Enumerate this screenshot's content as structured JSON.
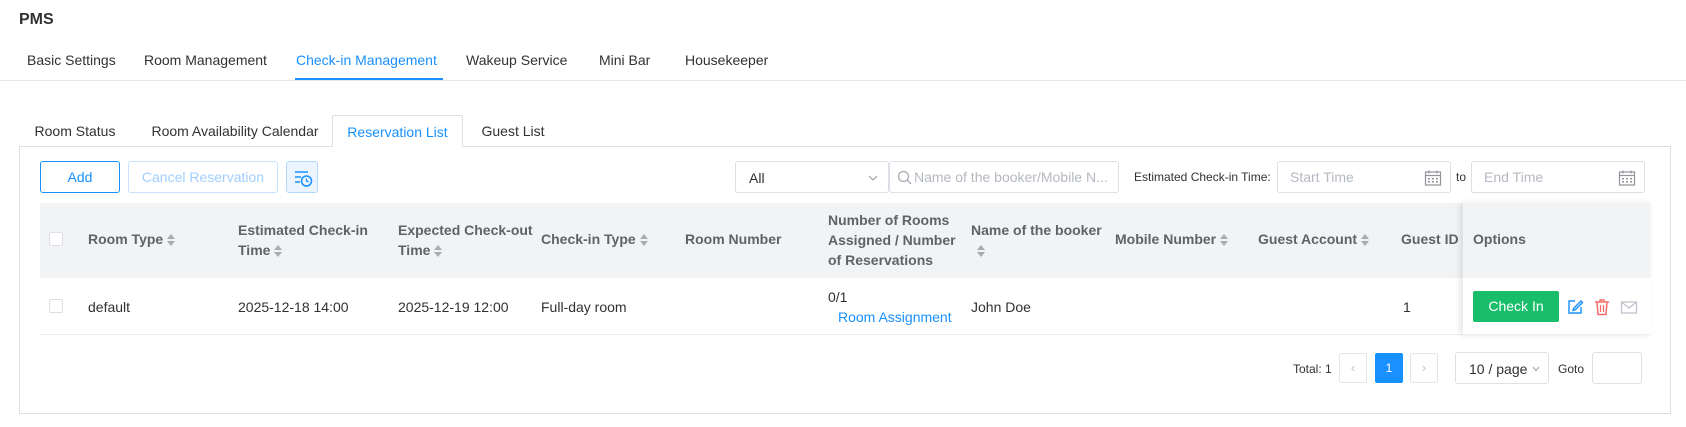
{
  "app": {
    "title": "PMS"
  },
  "top_tabs": [
    {
      "label": "Basic Settings"
    },
    {
      "label": "Room Management"
    },
    {
      "label": "Check-in Management",
      "active": true
    },
    {
      "label": "Wakeup Service"
    },
    {
      "label": "Mini Bar"
    },
    {
      "label": "Housekeeper"
    }
  ],
  "sub_tabs": [
    {
      "label": "Room Status"
    },
    {
      "label": "Room Availability Calendar"
    },
    {
      "label": "Reservation List",
      "active": true
    },
    {
      "label": "Guest List"
    }
  ],
  "toolbar": {
    "add_label": "Add",
    "cancel_label": "Cancel Reservation",
    "history_icon": "list-clock-icon",
    "status_select": "All",
    "search_placeholder": "Name of the booker/Mobile N...",
    "time_label": "Estimated Check-in Time:",
    "start_placeholder": "Start Time",
    "to_label": "to",
    "end_placeholder": "End Time"
  },
  "table": {
    "columns": {
      "room_type": "Room Type",
      "checkin_time_1": "Estimated Check-in",
      "checkin_time_2": "Time",
      "checkout_time_1": "Expected Check-out",
      "checkout_time_2": "Time",
      "checkin_type": "Check-in Type",
      "room_number": "Room Number",
      "rooms_assigned_1": "Number of Rooms",
      "rooms_assigned_2": "Assigned / Number",
      "rooms_assigned_3": "of Reservations",
      "booker_name": "Name of the booker",
      "mobile_number": "Mobile Number",
      "guest_account": "Guest Account",
      "guest_id": "Guest ID",
      "options": "Options"
    },
    "rows": [
      {
        "room_type": "default",
        "checkin_time": "2025-12-18 14:00",
        "checkout_time": "2025-12-19 12:00",
        "checkin_type": "Full-day room",
        "room_number": "",
        "rooms_assigned": "0/1",
        "room_assignment_link": "Room Assignment",
        "booker_name": "John Doe",
        "mobile_number": "",
        "guest_account": "",
        "guest_id": "1",
        "checkin_button": "Check In"
      }
    ]
  },
  "pagination": {
    "total_text": "Total: 1",
    "current_page": "1",
    "page_size": "10 / page",
    "goto_label": "Goto",
    "goto_value": ""
  },
  "colors": {
    "accent": "#1890ff",
    "success": "#19be6b",
    "danger": "#f56c6c"
  }
}
